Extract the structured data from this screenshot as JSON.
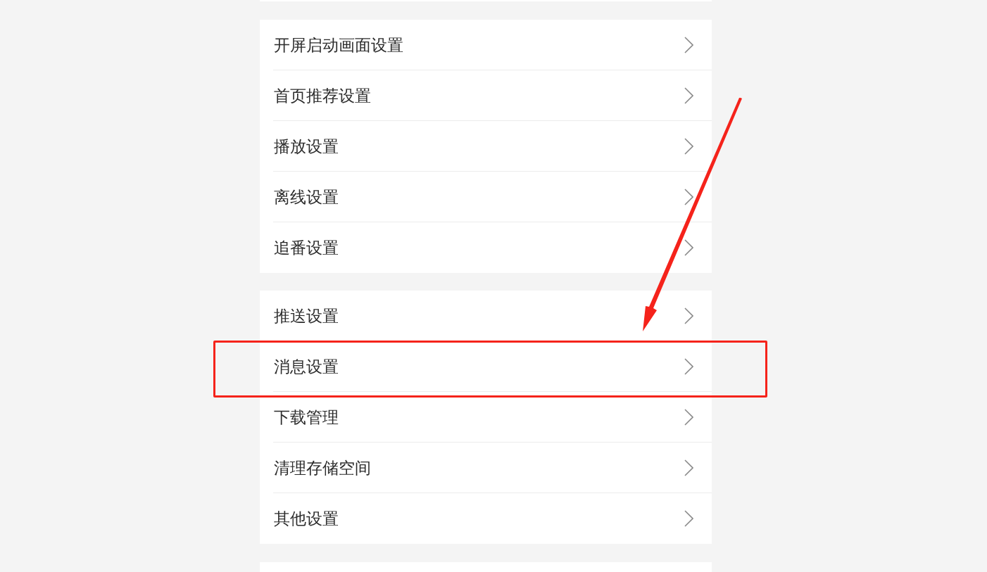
{
  "groups": [
    {
      "items": [
        {
          "label": "开屏启动画面设置",
          "highlighted": false
        },
        {
          "label": "首页推荐设置",
          "highlighted": false
        },
        {
          "label": "播放设置",
          "highlighted": false
        },
        {
          "label": "离线设置",
          "highlighted": false
        },
        {
          "label": "追番设置",
          "highlighted": false
        }
      ]
    },
    {
      "items": [
        {
          "label": "推送设置",
          "highlighted": false
        },
        {
          "label": "消息设置",
          "highlighted": true
        },
        {
          "label": "下载管理",
          "highlighted": false
        },
        {
          "label": "清理存储空间",
          "highlighted": false
        },
        {
          "label": "其他设置",
          "highlighted": false
        }
      ]
    }
  ]
}
